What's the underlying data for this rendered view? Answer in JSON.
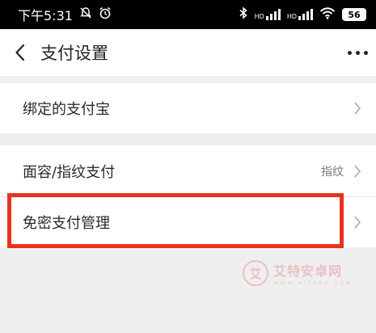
{
  "status_bar": {
    "time": "下午5:31",
    "network_badge": "HD",
    "battery_level": "56"
  },
  "header": {
    "title": "支付设置"
  },
  "settings": {
    "bound_alipay": {
      "label": "绑定的支付宝"
    },
    "face_fingerprint": {
      "label": "面容/指纹支付",
      "value": "指纹"
    },
    "password_free": {
      "label": "免密支付管理"
    }
  },
  "highlight": {
    "color": "#e8321f"
  },
  "watermark": {
    "logo_glyph": "艾",
    "name": "艾特安卓网",
    "domain": "WWW.AITEAZ.COM"
  }
}
